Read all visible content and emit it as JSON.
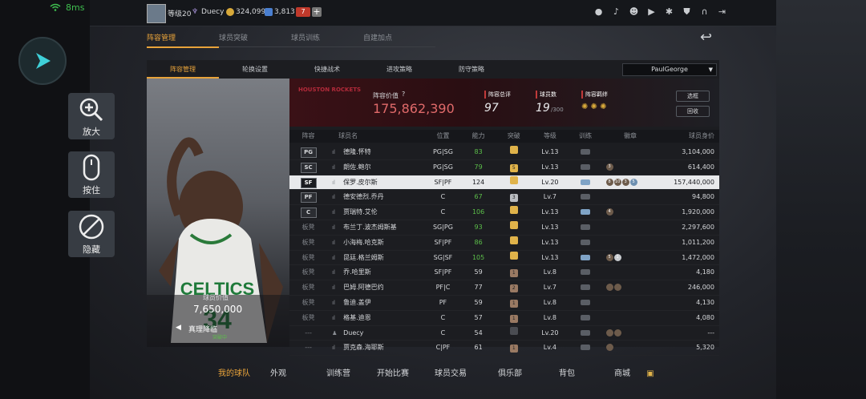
{
  "status": {
    "fps": "8ms"
  },
  "top": {
    "level": "等级20",
    "username": "Duecy",
    "coins": "324,099",
    "stars": "3,813",
    "badge": "7",
    "plus": "+"
  },
  "tabs_main": [
    "阵容管理",
    "球员突破",
    "球员训练",
    "自建加点"
  ],
  "tabs_sub": [
    "阵容管理",
    "轮换设置",
    "快捷战术",
    "进攻策略",
    "防守策略"
  ],
  "player_select": "PaulGeorge",
  "player_card": {
    "value_label": "球员价值",
    "value": "7,650,000",
    "card_name": "真理降临",
    "card_status": "突破中",
    "jersey_team": "CELTICS",
    "jersey_number": "34"
  },
  "team": {
    "logo_text": "HOUSTON ROCKETS",
    "lineup_value_label": "阵容价值",
    "lineup_value": "175,862,390",
    "overall_label": "阵容总评",
    "overall": "97",
    "count_label": "球员数",
    "count": "19",
    "count_max": "/300",
    "bond_label": "阵容羁绊",
    "btn_select": "选框",
    "btn_recycle": "回收"
  },
  "table": {
    "headers": [
      "阵容",
      "球员名",
      "位置",
      "能力",
      "突破",
      "等级",
      "训练",
      "徽章",
      "球员身价"
    ],
    "rows": [
      {
        "slot": "PG",
        "starter": true,
        "name": "德隆.怀特",
        "pos": "PG|SG",
        "ability": "83",
        "green": true,
        "brk": "",
        "brk_color": "#e0b34a",
        "lvl": "Lv.13",
        "train": false,
        "medals": [],
        "value": "3,104,000"
      },
      {
        "slot": "SC",
        "starter": true,
        "name": "朗佐.鲍尔",
        "pos": "PG|SG",
        "ability": "79",
        "green": true,
        "brk": "5",
        "brk_color": "#e0b34a",
        "lvl": "Lv.13",
        "train": false,
        "medals": [
          "3"
        ],
        "value": "614,400"
      },
      {
        "slot": "SF",
        "starter": true,
        "selected": true,
        "name": "保罗.皮尔斯",
        "pos": "SF|PF",
        "ability": "124",
        "green": false,
        "brk": "",
        "brk_color": "#e0b34a",
        "lvl": "Lv.20",
        "train": true,
        "medals": [
          "8",
          "10",
          "3",
          "5"
        ],
        "value": "157,440,000"
      },
      {
        "slot": "PF",
        "starter": true,
        "name": "德安德烈.乔丹",
        "pos": "C",
        "ability": "67",
        "green": true,
        "brk": "3",
        "brk_color": "#b9bcc0",
        "lvl": "Lv.7",
        "train": false,
        "medals": [],
        "value": "94,800"
      },
      {
        "slot": "C",
        "starter": true,
        "name": "贾瑞特.艾伦",
        "pos": "C",
        "ability": "106",
        "green": true,
        "brk": "",
        "brk_color": "#e0b34a",
        "lvl": "Lv.13",
        "train": true,
        "medals": [
          "4"
        ],
        "value": "1,920,000"
      },
      {
        "slot": "板凳",
        "starter": false,
        "name": "布兰丁.波杰姆斯基",
        "pos": "SG|PG",
        "ability": "93",
        "green": true,
        "brk": "",
        "brk_color": "#e0b34a",
        "lvl": "Lv.13",
        "train": false,
        "medals": [],
        "value": "2,297,600"
      },
      {
        "slot": "板凳",
        "starter": false,
        "name": "小海梅.哈克斯",
        "pos": "SF|PF",
        "ability": "86",
        "green": true,
        "brk": "",
        "brk_color": "#e0b34a",
        "lvl": "Lv.13",
        "train": false,
        "medals": [],
        "value": "1,011,200"
      },
      {
        "slot": "板凳",
        "starter": false,
        "name": "昆廷.格兰姆斯",
        "pos": "SG|SF",
        "ability": "105",
        "green": true,
        "brk": "",
        "brk_color": "#e0b34a",
        "lvl": "Lv.13",
        "train": true,
        "medals": [
          "5",
          "1"
        ],
        "value": "1,472,000"
      },
      {
        "slot": "板凳",
        "starter": false,
        "name": "乔.哈里斯",
        "pos": "SF|PF",
        "ability": "59",
        "green": false,
        "brk": "1",
        "brk_color": "#9a7a63",
        "lvl": "Lv.8",
        "train": false,
        "medals": [],
        "value": "4,180"
      },
      {
        "slot": "板凳",
        "starter": false,
        "name": "巴姆.阿德巴约",
        "pos": "PF|C",
        "ability": "77",
        "green": false,
        "brk": "2",
        "brk_color": "#9a7a63",
        "lvl": "Lv.7",
        "train": false,
        "medals": [
          "",
          ""
        ],
        "value": "246,000"
      },
      {
        "slot": "板凳",
        "starter": false,
        "name": "鲁迪.盖伊",
        "pos": "PF",
        "ability": "59",
        "green": false,
        "brk": "1",
        "brk_color": "#9a7a63",
        "lvl": "Lv.8",
        "train": false,
        "medals": [],
        "value": "4,130"
      },
      {
        "slot": "板凳",
        "starter": false,
        "name": "格基.迪恩",
        "pos": "C",
        "ability": "57",
        "green": false,
        "brk": "1",
        "brk_color": "#9a7a63",
        "lvl": "Lv.8",
        "train": false,
        "medals": [],
        "value": "4,080"
      },
      {
        "slot": "---",
        "starter": false,
        "name": "Duecy",
        "pos": "C",
        "ability": "54",
        "green": false,
        "brk": "",
        "brk_color": "#4a4c52",
        "lvl": "Lv.20",
        "train": false,
        "medals": [
          "",
          ""
        ],
        "value": "---"
      },
      {
        "slot": "---",
        "starter": false,
        "name": "贾克森.海耶斯",
        "pos": "C|PF",
        "ability": "61",
        "green": false,
        "brk": "1",
        "brk_color": "#9a7a63",
        "lvl": "Lv.4",
        "train": false,
        "medals": [
          ""
        ],
        "value": "5,320"
      }
    ]
  },
  "side_buttons": [
    "放大",
    "按住",
    "隐藏"
  ],
  "bottom_nav": [
    "我的球队",
    "外观",
    "训练营",
    "开始比赛",
    "球员交易",
    "俱乐部",
    "背包",
    "商城"
  ]
}
